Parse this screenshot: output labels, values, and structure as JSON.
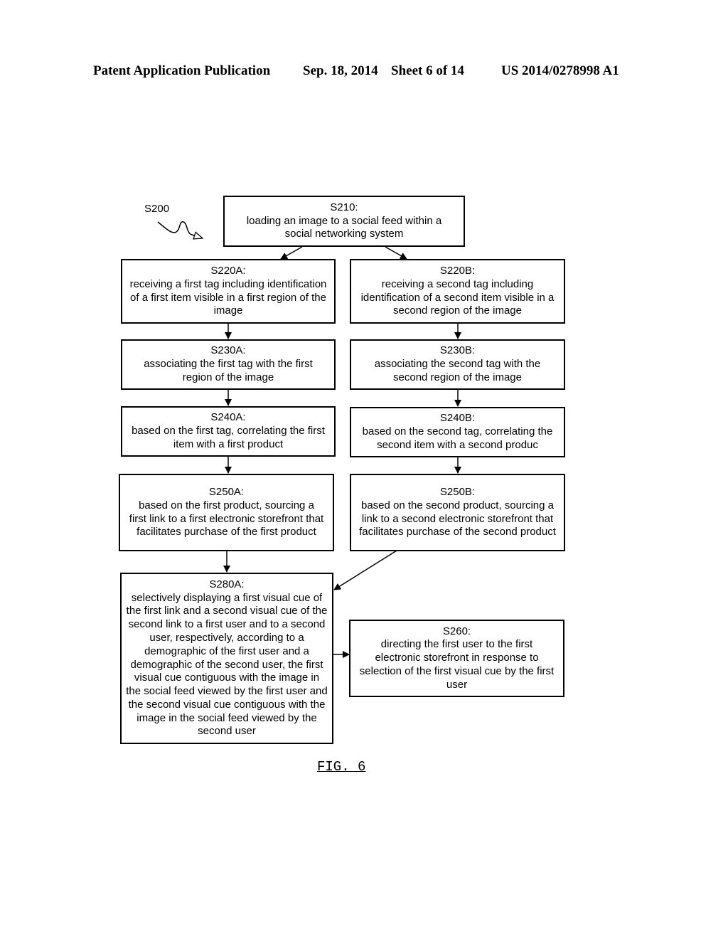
{
  "header": {
    "publication": "Patent Application Publication",
    "date": "Sep. 18, 2014",
    "sheet": "Sheet 6 of 14",
    "number": "US 2014/0278998 A1"
  },
  "diagram": {
    "method_label": "S200",
    "figure_label": "FIG. 6",
    "steps": {
      "s210": {
        "id": "S210:",
        "text": "loading an image to a social feed within a social networking system"
      },
      "s220a": {
        "id": "S220A:",
        "text": "receiving a first tag including identification of a first item visible in a first region of the image"
      },
      "s220b": {
        "id": "S220B:",
        "text": "receiving a second tag including identification of a second item visible in a second region of the image"
      },
      "s230a": {
        "id": "S230A:",
        "text": "associating the first tag with the first region of the image"
      },
      "s230b": {
        "id": "S230B:",
        "text": "associating the second tag with the second region of the image"
      },
      "s240a": {
        "id": "S240A:",
        "text": "based on the first tag, correlating the first item with a first product"
      },
      "s240b": {
        "id": "S240B:",
        "text": "based on the second tag, correlating the second item with a second produc"
      },
      "s250a": {
        "id": "S250A:",
        "text": "based on the first product, sourcing a first link to a first electronic storefront that facilitates purchase of the first product"
      },
      "s250b": {
        "id": "S250B:",
        "text": "based on the second product, sourcing a link to a second electronic storefront that facilitates purchase of the second product"
      },
      "s280a": {
        "id": "S280A:",
        "text": "selectively displaying a first visual cue of the first link and a second visual cue of the second link to a first user and to a second user, respectively, according to a demographic of the first user and a demographic of the second user, the first visual cue contiguous with the image in the social feed viewed by the first user and the second visual cue contiguous with the image in the social feed viewed by the second user"
      },
      "s260": {
        "id": "S260:",
        "text": "directing the first user to the first electronic storefront in response to selection of the first visual cue by the first user"
      }
    },
    "connections": [
      {
        "from": "S210",
        "to": "S220A"
      },
      {
        "from": "S210",
        "to": "S220B"
      },
      {
        "from": "S220A",
        "to": "S230A"
      },
      {
        "from": "S220B",
        "to": "S230B"
      },
      {
        "from": "S230A",
        "to": "S240A"
      },
      {
        "from": "S230B",
        "to": "S240B"
      },
      {
        "from": "S240A",
        "to": "S250A"
      },
      {
        "from": "S240B",
        "to": "S250B"
      },
      {
        "from": "S250A",
        "to": "S280A"
      },
      {
        "from": "S250B",
        "to": "S280A"
      },
      {
        "from": "S280A",
        "to": "S260"
      }
    ]
  }
}
